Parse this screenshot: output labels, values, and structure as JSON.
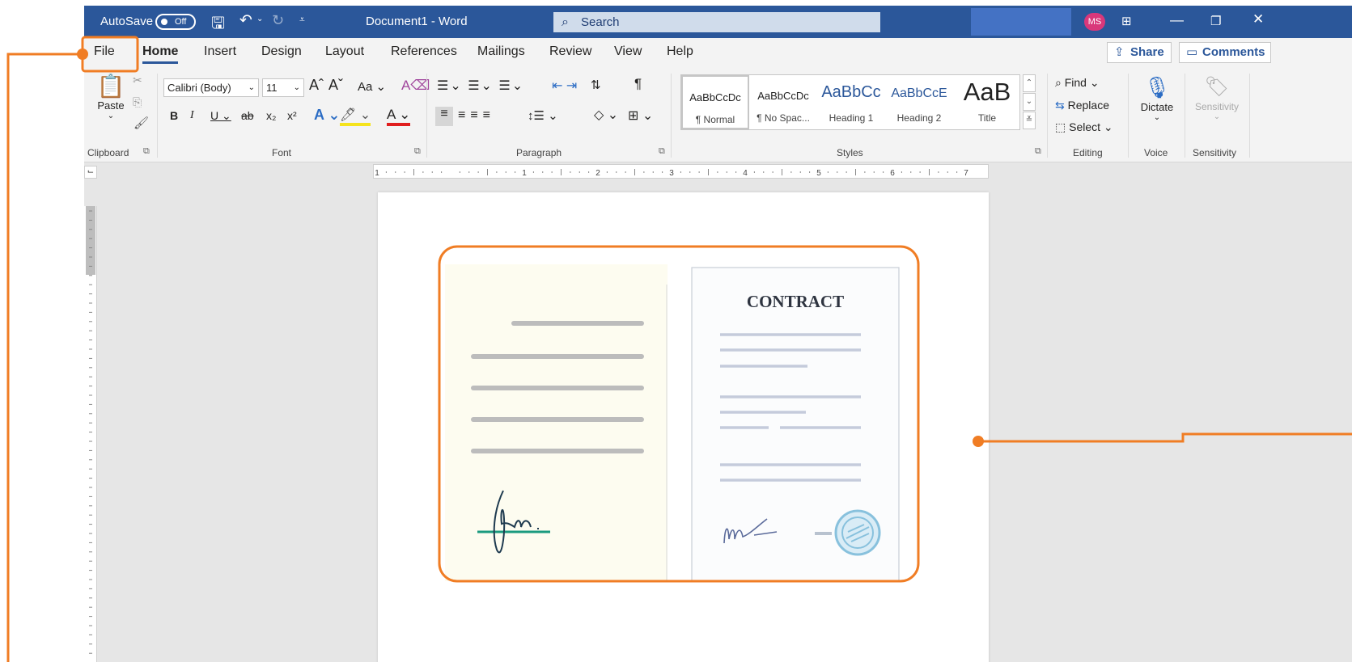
{
  "titlebar": {
    "autosave_label": "AutoSave",
    "autosave_state": "Off",
    "doc_title": "Document1  -  Word",
    "search_placeholder": "Search",
    "avatar_initials": "MS",
    "bg_color": "#2b579a"
  },
  "tabs": [
    "File",
    "Home",
    "Insert",
    "Design",
    "Layout",
    "References",
    "Mailings",
    "Review",
    "View",
    "Help"
  ],
  "active_tab": "Home",
  "share_label": "Share",
  "comments_label": "Comments",
  "clipboard": {
    "paste_label": "Paste",
    "group_label": "Clipboard"
  },
  "font": {
    "family": "Calibri (Body)",
    "size": "11",
    "change_case": "Aa",
    "group_label": "Font"
  },
  "paragraph": {
    "group_label": "Paragraph"
  },
  "styles": {
    "items": [
      {
        "preview": "AaBbCcDc",
        "name": "¶ Normal"
      },
      {
        "preview": "AaBbCcDc",
        "name": "¶ No Spac..."
      },
      {
        "preview": "AaBbCc",
        "name": "Heading 1"
      },
      {
        "preview": "AaBbCcE",
        "name": "Heading 2"
      },
      {
        "preview": "AaB",
        "name": "Title"
      }
    ],
    "group_label": "Styles"
  },
  "editing": {
    "find": "Find",
    "replace": "Replace",
    "select": "Select",
    "group_label": "Editing"
  },
  "voice": {
    "dictate": "Dictate",
    "group_label": "Voice"
  },
  "sensitivity": {
    "label": "Sensitivity",
    "group_label": "Sensitivity"
  },
  "ruler_numbers": [
    "1",
    "1",
    "2",
    "3",
    "4",
    "5",
    "6",
    "7"
  ],
  "illustration": {
    "contract_title": "CONTRACT"
  },
  "accent_color": "#f07d24"
}
